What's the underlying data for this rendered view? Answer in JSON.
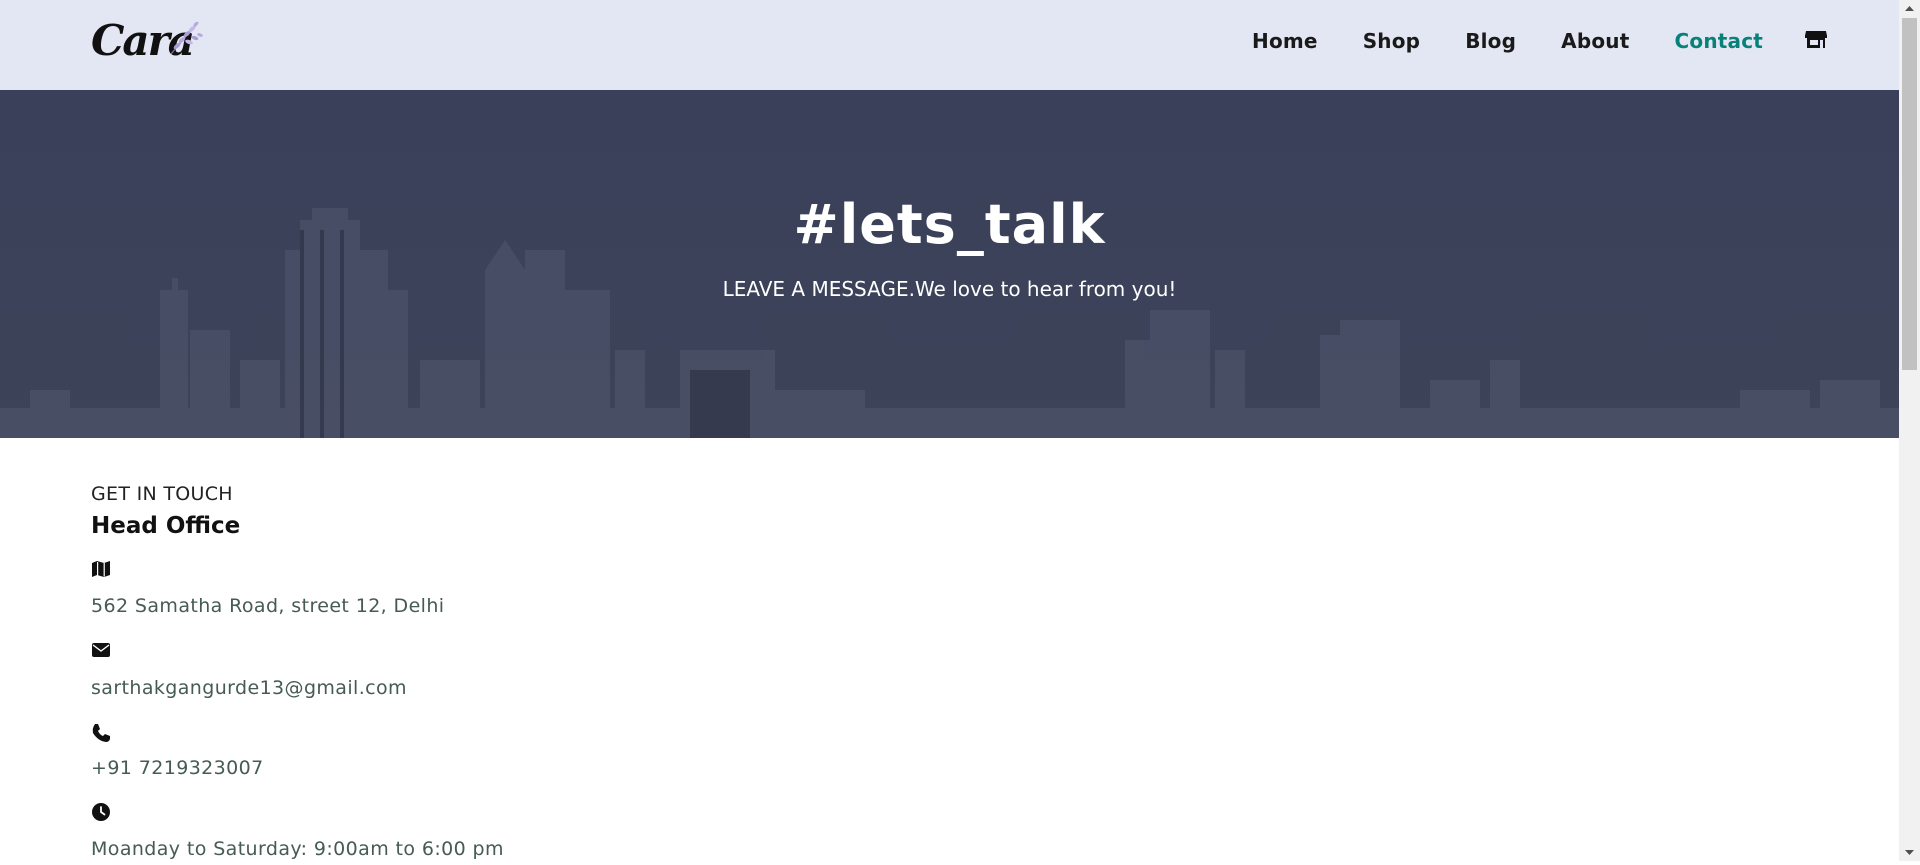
{
  "header": {
    "logo_text": "Cara",
    "nav": [
      {
        "label": "Home"
      },
      {
        "label": "Shop"
      },
      {
        "label": "Blog"
      },
      {
        "label": "About"
      },
      {
        "label": "Contact",
        "active": true
      }
    ],
    "cart_icon": "shopping-bag-icon",
    "active_color": "#088178",
    "background": "#e3e6f3"
  },
  "hero": {
    "title": "#lets_talk",
    "subtitle": "LEAVE A MESSAGE.We love to hear from you!",
    "background": "#3b4158"
  },
  "contact": {
    "eyebrow": "GET IN TOUCH",
    "heading": "Head Office",
    "items": [
      {
        "icon": "map-icon",
        "text": "562 Samatha Road, street 12, Delhi"
      },
      {
        "icon": "envelope-icon",
        "text": "sarthakgangurde13@gmail.com"
      },
      {
        "icon": "phone-icon",
        "text": "+91 7219323007"
      },
      {
        "icon": "clock-icon",
        "text": "Moanday to Saturday: 9:00am to 6:00 pm"
      }
    ]
  }
}
